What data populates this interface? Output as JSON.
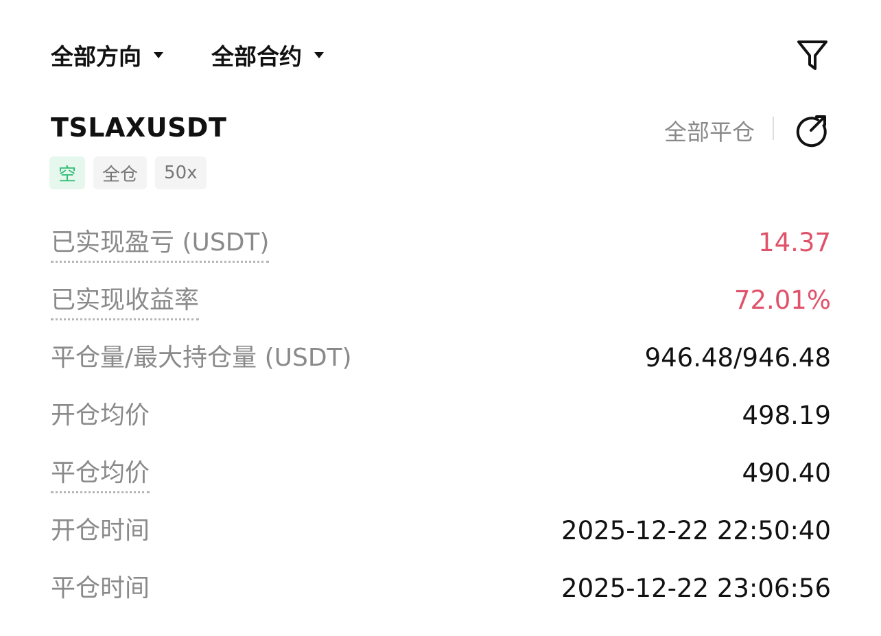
{
  "filters": {
    "direction_label": "全部方向",
    "contract_label": "全部合约",
    "filter_icon": "filter-icon"
  },
  "position": {
    "symbol": "TSLAXUSDT",
    "close_all_label": "全部平仓",
    "share_icon": "share-icon",
    "tags": {
      "side": "空",
      "margin_mode": "全仓",
      "leverage": "50x"
    },
    "colors": {
      "pnl": "#e0526a",
      "short_tag_text": "#2fbd72",
      "short_tag_bg": "#e6f7ee"
    }
  },
  "details": {
    "realized_pnl": {
      "label": "已实现盈亏 (USDT)",
      "value": "14.37"
    },
    "realized_roi": {
      "label": "已实现收益率",
      "value": "72.01%"
    },
    "closed_max_size": {
      "label": "平仓量/最大持仓量 (USDT)",
      "value": "946.48/946.48"
    },
    "avg_open_price": {
      "label": "开仓均价",
      "value": "498.19"
    },
    "avg_close_price": {
      "label": "平仓均价",
      "value": "490.40"
    },
    "open_time": {
      "label": "开仓时间",
      "value": "2025-12-22 22:50:40"
    },
    "close_time": {
      "label": "平仓时间",
      "value": "2025-12-22 23:06:56"
    }
  }
}
